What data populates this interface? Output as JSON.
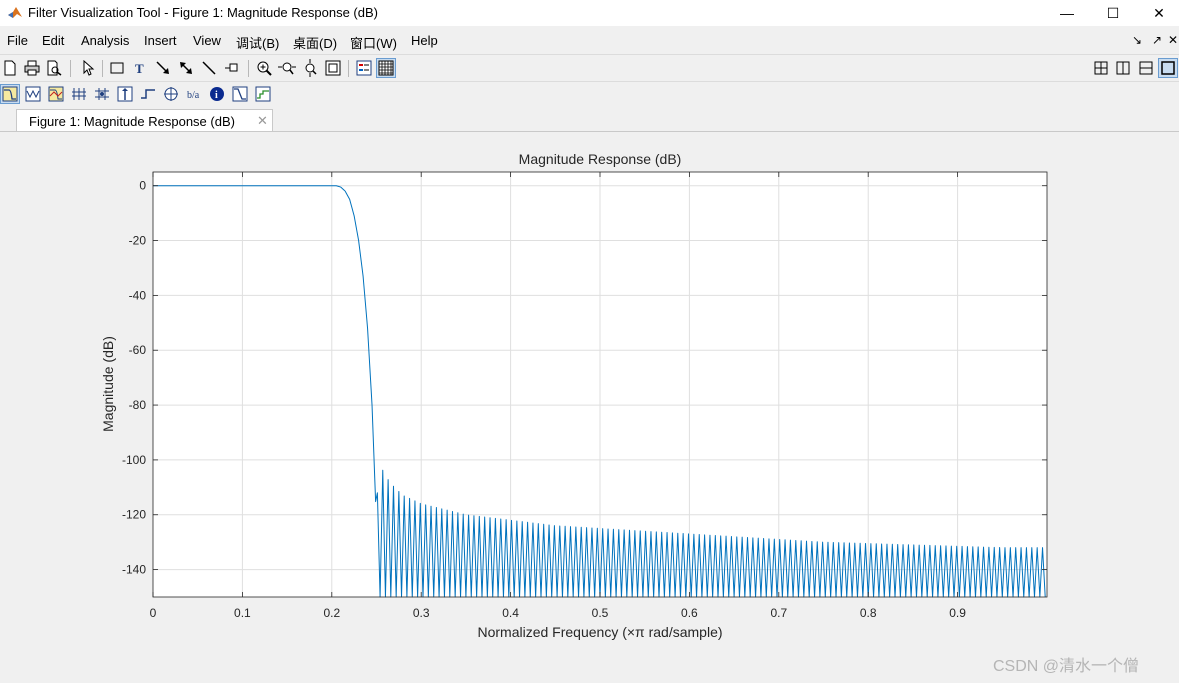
{
  "window": {
    "title": "Filter Visualization Tool - Figure 1: Magnitude Response (dB)",
    "controls": {
      "minimize": "—",
      "maximize": "☐",
      "close": "✕"
    }
  },
  "menubar": {
    "items": [
      {
        "label": "File"
      },
      {
        "label": "Edit"
      },
      {
        "label": "Analysis"
      },
      {
        "label": "Insert"
      },
      {
        "label": "View"
      },
      {
        "label": "调试(B)"
      },
      {
        "label": "桌面(D)"
      },
      {
        "label": "窗口(W)"
      },
      {
        "label": "Help"
      }
    ],
    "right_icons": [
      "↘",
      "↗",
      "✕"
    ]
  },
  "tab": {
    "label": "Figure 1: Magnitude Response (dB)",
    "close": "✕"
  },
  "watermark": "CSDN @清水一个僧",
  "colors": {
    "line": "#0072bd",
    "grid": "#dfdfdf",
    "axes_bg": "#ffffff"
  },
  "chart_data": {
    "type": "line",
    "title": "Magnitude Response (dB)",
    "xlabel": "Normalized Frequency (×π rad/sample)",
    "ylabel": "Magnitude (dB)",
    "xlim": [
      0,
      1
    ],
    "ylim": [
      -150,
      5
    ],
    "xticks": [
      "0",
      "0.1",
      "0.2",
      "0.3",
      "0.4",
      "0.5",
      "0.6",
      "0.7",
      "0.8",
      "0.9"
    ],
    "xtick_values": [
      0,
      0.1,
      0.2,
      0.3,
      0.4,
      0.5,
      0.6,
      0.7,
      0.8,
      0.9
    ],
    "yticks": [
      "0",
      "-20",
      "-40",
      "-60",
      "-80",
      "-100",
      "-120",
      "-140"
    ],
    "ytick_values": [
      0,
      -20,
      -40,
      -60,
      -80,
      -100,
      -120,
      -140
    ],
    "grid": true,
    "series": [
      {
        "x": [
          0,
          0.1,
          0.2,
          0.205,
          0.21,
          0.215,
          0.22,
          0.225,
          0.23,
          0.235,
          0.24,
          0.245,
          0.25,
          0.252,
          0.26,
          0.27,
          0.28,
          0.3,
          0.35,
          0.4,
          0.45,
          0.5,
          0.55,
          0.6,
          0.65,
          0.7,
          0.75,
          0.8,
          0.85,
          0.9,
          0.95,
          1.0
        ],
        "y": [
          0,
          0,
          0,
          0,
          -0.5,
          -2,
          -5,
          -11,
          -20,
          -33,
          -52,
          -80,
          -124,
          -100,
          -106,
          -110,
          -113,
          -116,
          -120,
          -122,
          -124,
          -125,
          -126,
          -127,
          -128,
          -129,
          -130,
          -130.5,
          -131,
          -131.5,
          -132,
          -132
        ]
      }
    ]
  }
}
